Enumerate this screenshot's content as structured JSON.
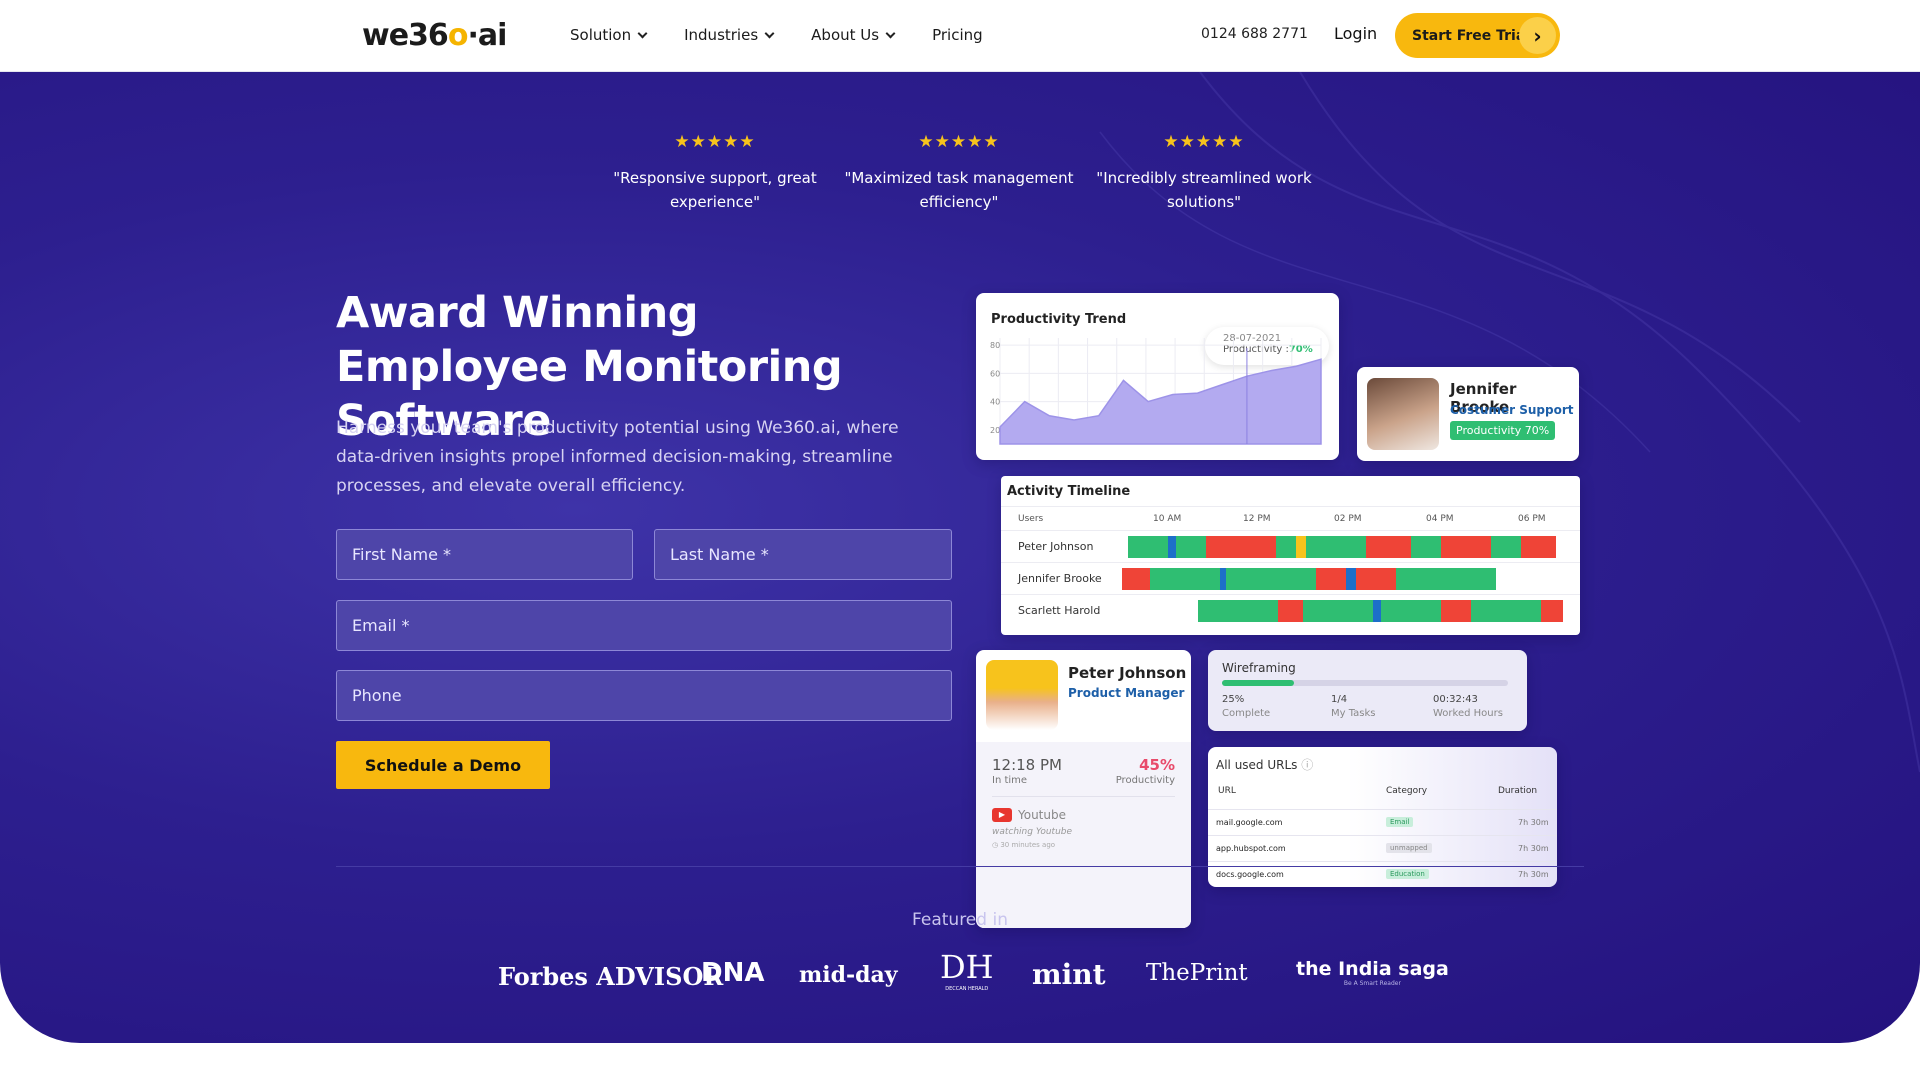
{
  "nav": {
    "logo_text": "we36",
    "logo_accent": "o",
    "logo_suffix": "·ai",
    "items": [
      "Solution",
      "Industries",
      "About Us",
      "Pricing"
    ],
    "phone": "0124 688 2771",
    "login": "Login",
    "cta": "Start Free Trial",
    "cta_icon": "chevron-right-icon"
  },
  "testimonials": [
    {
      "stars": "★★★★★",
      "quote": "\"Responsive support, great experience\""
    },
    {
      "stars": "★★★★★",
      "quote": "\"Maximized task management efficiency\""
    },
    {
      "stars": "★★★★★",
      "quote": "\"Incredibly streamlined work solutions\""
    }
  ],
  "hero": {
    "title": "Award Winning Employee Monitoring Software",
    "subtitle": "Harness your team's productivity potential using We360.ai, where data-driven insights propel informed decision-making, streamline processes, and elevate overall efficiency."
  },
  "form": {
    "first_name": "First Name *",
    "last_name": "Last Name *",
    "email": "Email *",
    "phone": "Phone",
    "submit": "Schedule a Demo"
  },
  "featured": {
    "label": "Featured in",
    "logos": [
      "Forbes ADVISOR",
      "DNA",
      "mid-day",
      "DH",
      "mint",
      "ThePrint",
      "the India saga"
    ],
    "saga_tag": "Be A Smart Reader",
    "dh_tag": "DECCAN HERALD"
  },
  "trend": {
    "title": "Productivity Trend",
    "tooltip_date": "28-07-2021",
    "tooltip_label": "Productivity :",
    "tooltip_value": "70%",
    "y_ticks": [
      "80",
      "60",
      "40",
      "20"
    ]
  },
  "chart_data": {
    "type": "area",
    "title": "Productivity Trend",
    "x": [
      0,
      1,
      2,
      3,
      4,
      5,
      6,
      7,
      8,
      9,
      10,
      11,
      12,
      13
    ],
    "values": [
      22,
      40,
      30,
      27,
      30,
      55,
      40,
      45,
      46,
      52,
      58,
      62,
      65,
      70
    ],
    "ylim": [
      10,
      85
    ],
    "grid": true
  },
  "jennifer": {
    "name": "Jennifer Brooke",
    "role": "Costumer Support",
    "badge": "Productivity 70%"
  },
  "timeline": {
    "title": "Activity Timeline",
    "header": [
      "Users",
      "10 AM",
      "12 PM",
      "02 PM",
      "04 PM",
      "06 PM"
    ],
    "users": [
      "Peter Johnson",
      "Jennifer Brooke",
      "Scarlett Harold"
    ]
  },
  "peter": {
    "name": "Peter Johnson",
    "role": "Product Manager",
    "time": "12:18 PM",
    "time_label": "In time",
    "prod": "45%",
    "prod_label": "Productivity",
    "app": "Youtube",
    "app_status": "watching Youtube",
    "app_ago": "30 minutes ago"
  },
  "task": {
    "title": "Wireframing",
    "complete": "25%",
    "complete_label": "Complete",
    "tasks": "1/4",
    "tasks_label": "My Tasks",
    "hours": "00:32:43",
    "hours_label": "Worked Hours",
    "progress": 0.25
  },
  "urls": {
    "title": "All used URLs",
    "cols": [
      "URL",
      "Category",
      "Duration"
    ],
    "rows": [
      {
        "url": "mail.google.com",
        "cat": "Email",
        "dur": "7h 30m"
      },
      {
        "url": "app.hubspot.com",
        "cat": "unmapped",
        "dur": "7h 30m"
      },
      {
        "url": "docs.google.com",
        "cat": "Education",
        "dur": "7h 30m"
      }
    ]
  },
  "colors": {
    "accent": "#f8b80e",
    "hero_bg": "#2d1f8f",
    "good": "#2fbe72",
    "bad": "#ef4437",
    "idle": "#1d6fc9"
  }
}
